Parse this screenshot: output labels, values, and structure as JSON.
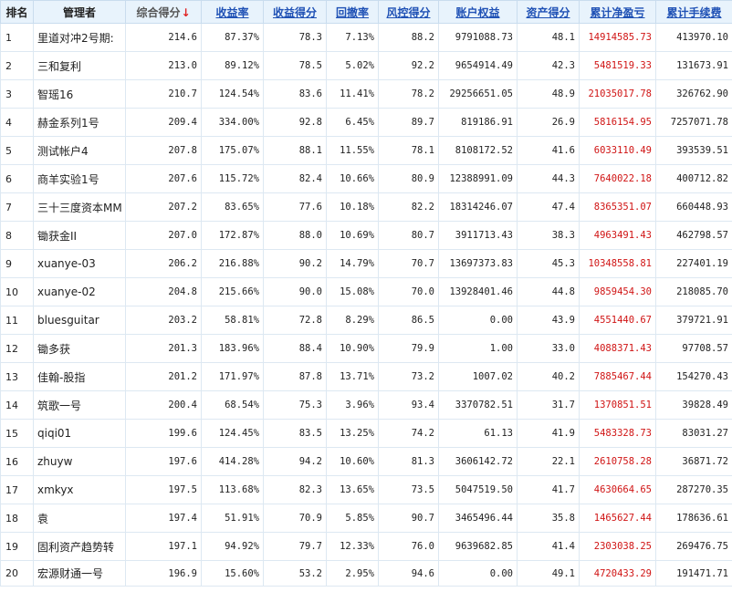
{
  "columns": {
    "rank": "排名",
    "manager": "管理者",
    "score": "综合得分",
    "score_sort_icon": "↓",
    "return_rate": "收益率",
    "return_score": "收益得分",
    "drawdown": "回撤率",
    "risk_score": "风控得分",
    "equity": "账户权益",
    "asset_score": "资产得分",
    "net_pnl": "累计净盈亏",
    "fees": "累计手续费"
  },
  "colors": {
    "header_bg": "#e8f3fc",
    "link": "#1f51b5",
    "pnl": "#d01414",
    "sort_arrow": "#e02222"
  },
  "rows": [
    {
      "rank": "1",
      "manager": "里道对冲2号期:",
      "score": "214.6",
      "return_rate": "87.37%",
      "return_score": "78.3",
      "drawdown": "7.13%",
      "risk_score": "88.2",
      "equity": "9791088.73",
      "asset_score": "48.1",
      "net_pnl": "14914585.73",
      "fees": "413970.10"
    },
    {
      "rank": "2",
      "manager": "三和复利",
      "score": "213.0",
      "return_rate": "89.12%",
      "return_score": "78.5",
      "drawdown": "5.02%",
      "risk_score": "92.2",
      "equity": "9654914.49",
      "asset_score": "42.3",
      "net_pnl": "5481519.33",
      "fees": "131673.91"
    },
    {
      "rank": "3",
      "manager": "智瑶16",
      "score": "210.7",
      "return_rate": "124.54%",
      "return_score": "83.6",
      "drawdown": "11.41%",
      "risk_score": "78.2",
      "equity": "29256651.05",
      "asset_score": "48.9",
      "net_pnl": "21035017.78",
      "fees": "326762.90"
    },
    {
      "rank": "4",
      "manager": "赫金系列1号",
      "score": "209.4",
      "return_rate": "334.00%",
      "return_score": "92.8",
      "drawdown": "6.45%",
      "risk_score": "89.7",
      "equity": "819186.91",
      "asset_score": "26.9",
      "net_pnl": "5816154.95",
      "fees": "7257071.78"
    },
    {
      "rank": "5",
      "manager": "测试帐户4",
      "score": "207.8",
      "return_rate": "175.07%",
      "return_score": "88.1",
      "drawdown": "11.55%",
      "risk_score": "78.1",
      "equity": "8108172.52",
      "asset_score": "41.6",
      "net_pnl": "6033110.49",
      "fees": "393539.51"
    },
    {
      "rank": "6",
      "manager": "商羊实验1号",
      "score": "207.6",
      "return_rate": "115.72%",
      "return_score": "82.4",
      "drawdown": "10.66%",
      "risk_score": "80.9",
      "equity": "12388991.09",
      "asset_score": "44.3",
      "net_pnl": "7640022.18",
      "fees": "400712.82"
    },
    {
      "rank": "7",
      "manager": "三十三度资本MM",
      "score": "207.2",
      "return_rate": "83.65%",
      "return_score": "77.6",
      "drawdown": "10.18%",
      "risk_score": "82.2",
      "equity": "18314246.07",
      "asset_score": "47.4",
      "net_pnl": "8365351.07",
      "fees": "660448.93"
    },
    {
      "rank": "8",
      "manager": "锄获金II",
      "score": "207.0",
      "return_rate": "172.87%",
      "return_score": "88.0",
      "drawdown": "10.69%",
      "risk_score": "80.7",
      "equity": "3911713.43",
      "asset_score": "38.3",
      "net_pnl": "4963491.43",
      "fees": "462798.57"
    },
    {
      "rank": "9",
      "manager": "xuanye-03",
      "score": "206.2",
      "return_rate": "216.88%",
      "return_score": "90.2",
      "drawdown": "14.79%",
      "risk_score": "70.7",
      "equity": "13697373.83",
      "asset_score": "45.3",
      "net_pnl": "10348558.81",
      "fees": "227401.19"
    },
    {
      "rank": "10",
      "manager": "xuanye-02",
      "score": "204.8",
      "return_rate": "215.66%",
      "return_score": "90.0",
      "drawdown": "15.08%",
      "risk_score": "70.0",
      "equity": "13928401.46",
      "asset_score": "44.8",
      "net_pnl": "9859454.30",
      "fees": "218085.70"
    },
    {
      "rank": "11",
      "manager": "bluesguitar",
      "score": "203.2",
      "return_rate": "58.81%",
      "return_score": "72.8",
      "drawdown": "8.29%",
      "risk_score": "86.5",
      "equity": "0.00",
      "asset_score": "43.9",
      "net_pnl": "4551440.67",
      "fees": "379721.91"
    },
    {
      "rank": "12",
      "manager": "锄多获",
      "score": "201.3",
      "return_rate": "183.96%",
      "return_score": "88.4",
      "drawdown": "10.90%",
      "risk_score": "79.9",
      "equity": "1.00",
      "asset_score": "33.0",
      "net_pnl": "4088371.43",
      "fees": "97708.57"
    },
    {
      "rank": "13",
      "manager": "佳翰-股指",
      "score": "201.2",
      "return_rate": "171.97%",
      "return_score": "87.8",
      "drawdown": "13.71%",
      "risk_score": "73.2",
      "equity": "1007.02",
      "asset_score": "40.2",
      "net_pnl": "7885467.44",
      "fees": "154270.43"
    },
    {
      "rank": "14",
      "manager": "筑歌一号",
      "score": "200.4",
      "return_rate": "68.54%",
      "return_score": "75.3",
      "drawdown": "3.96%",
      "risk_score": "93.4",
      "equity": "3370782.51",
      "asset_score": "31.7",
      "net_pnl": "1370851.51",
      "fees": "39828.49"
    },
    {
      "rank": "15",
      "manager": "qiqi01",
      "score": "199.6",
      "return_rate": "124.45%",
      "return_score": "83.5",
      "drawdown": "13.25%",
      "risk_score": "74.2",
      "equity": "61.13",
      "asset_score": "41.9",
      "net_pnl": "5483328.73",
      "fees": "83031.27"
    },
    {
      "rank": "16",
      "manager": "zhuyw",
      "score": "197.6",
      "return_rate": "414.28%",
      "return_score": "94.2",
      "drawdown": "10.60%",
      "risk_score": "81.3",
      "equity": "3606142.72",
      "asset_score": "22.1",
      "net_pnl": "2610758.28",
      "fees": "36871.72"
    },
    {
      "rank": "17",
      "manager": "xmkyx",
      "score": "197.5",
      "return_rate": "113.68%",
      "return_score": "82.3",
      "drawdown": "13.65%",
      "risk_score": "73.5",
      "equity": "5047519.50",
      "asset_score": "41.7",
      "net_pnl": "4630664.65",
      "fees": "287270.35"
    },
    {
      "rank": "18",
      "manager": "袁",
      "score": "197.4",
      "return_rate": "51.91%",
      "return_score": "70.9",
      "drawdown": "5.85%",
      "risk_score": "90.7",
      "equity": "3465496.44",
      "asset_score": "35.8",
      "net_pnl": "1465627.44",
      "fees": "178636.61"
    },
    {
      "rank": "19",
      "manager": "固利资产趋势转",
      "score": "197.1",
      "return_rate": "94.92%",
      "return_score": "79.7",
      "drawdown": "12.33%",
      "risk_score": "76.0",
      "equity": "9639682.85",
      "asset_score": "41.4",
      "net_pnl": "2303038.25",
      "fees": "269476.75"
    },
    {
      "rank": "20",
      "manager": "宏源财通一号",
      "score": "196.9",
      "return_rate": "15.60%",
      "return_score": "53.2",
      "drawdown": "2.95%",
      "risk_score": "94.6",
      "equity": "0.00",
      "asset_score": "49.1",
      "net_pnl": "4720433.29",
      "fees": "191471.71"
    }
  ]
}
